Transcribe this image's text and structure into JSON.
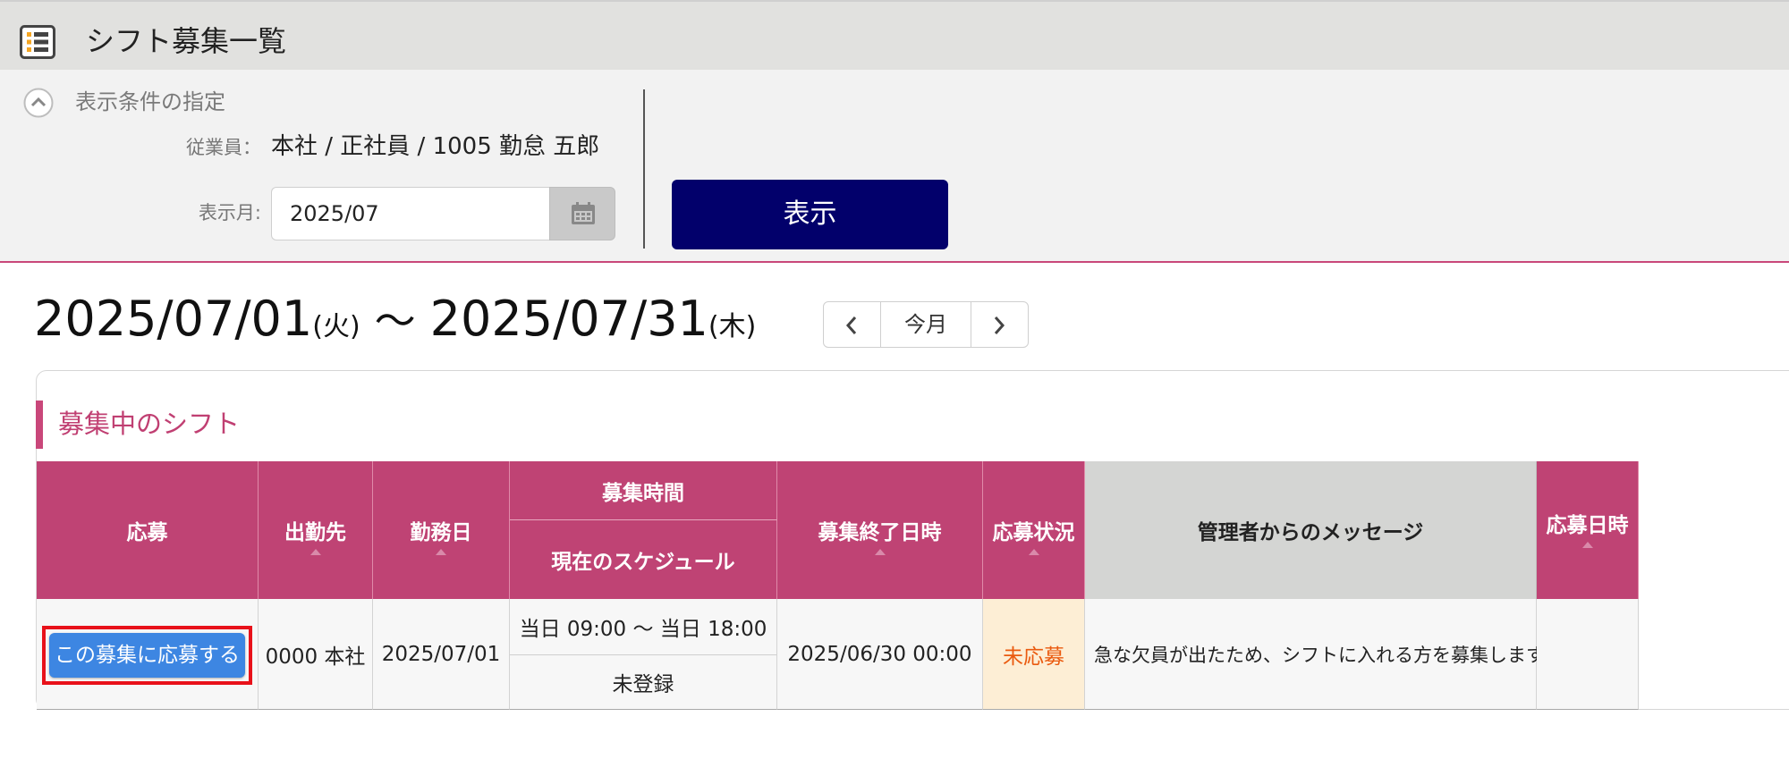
{
  "header": {
    "title": "シフト募集一覧",
    "icon": "list-icon"
  },
  "filter": {
    "heading": "表示条件の指定",
    "employee_label": "従業員：",
    "employee_value": "本社 / 正社員 / 1005 勤怠 五郎",
    "month_label": "表示月:",
    "month_value": "2025/07",
    "show_button": "表示"
  },
  "range": {
    "start": "2025/07/01",
    "start_weekday": "(火)",
    "separator": "〜",
    "end": "2025/07/31",
    "end_weekday": "(木)"
  },
  "pager": {
    "today": "今月"
  },
  "section": {
    "title": "募集中のシフト"
  },
  "table": {
    "headers": {
      "apply": "応募",
      "workplace": "出勤先",
      "work_date": "勤務日",
      "recruit_time": "募集時間",
      "current_schedule": "現在のスケジュール",
      "deadline": "募集終了日時",
      "status": "応募状況",
      "message": "管理者からのメッセージ",
      "applied_at": "応募日時"
    },
    "rows": [
      {
        "apply_button": "この募集に応募する",
        "workplace": "0000 本社",
        "work_date": "2025/07/01",
        "recruit_time": "当日 09:00 〜 当日 18:00",
        "current_schedule": "未登録",
        "deadline": "2025/06/30 00:00",
        "status": "未応募",
        "message": "急な欠員が出たため、シフトに入れる方を募集します。",
        "applied_at": ""
      }
    ]
  },
  "colors": {
    "accent": "#bf4374",
    "show_button": "#02006b",
    "apply_button": "#3d86e2",
    "status_text": "#ea5a0f",
    "highlight_border": "#e8111a"
  }
}
